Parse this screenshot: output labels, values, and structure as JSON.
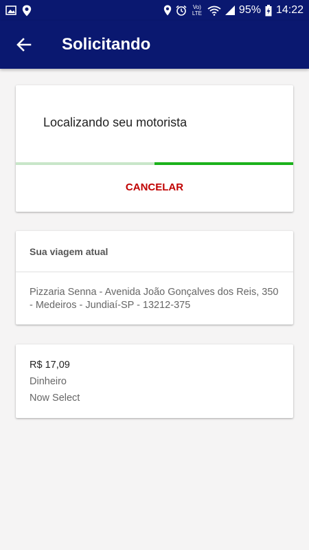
{
  "status_bar": {
    "battery": "95%",
    "time": "14:22",
    "network_label": "Vo) LTE"
  },
  "appbar": {
    "title": "Solicitando"
  },
  "request_card": {
    "message": "Localizando seu motorista",
    "progress": 0.5,
    "cancel_label": "CANCELAR"
  },
  "trip_card": {
    "header": "Sua viagem atual",
    "address": "Pizzaria Senna - Avenida João Gonçalves dos Reis, 350 - Medeiros - Jundiaí-SP - 13212-375"
  },
  "fare_card": {
    "price": "R$ 17,09",
    "payment_method": "Dinheiro",
    "category": "Now Select"
  },
  "colors": {
    "primary": "#0a1870",
    "progress_fill": "#1bb21b",
    "progress_track": "#c8e6c9",
    "cancel": "#c00000"
  }
}
